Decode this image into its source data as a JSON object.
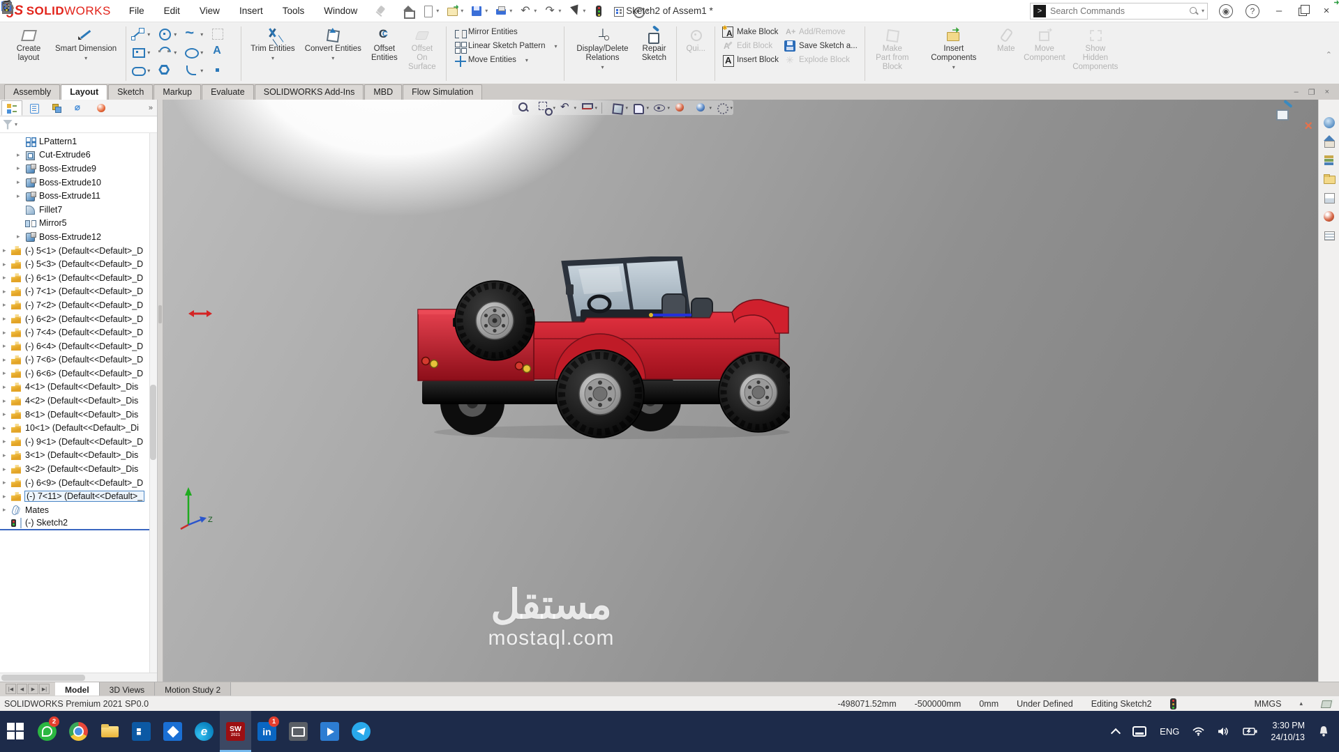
{
  "colors": {
    "brand_red": "#e2231a",
    "icon_blue": "#2b79b9",
    "taskbar_bg": "#1d2b4a",
    "selection_outline": "#4a86c5"
  },
  "titlebar": {
    "brand": "SOLIDWORKS",
    "menus": [
      {
        "label": "File"
      },
      {
        "label": "Edit"
      },
      {
        "label": "View"
      },
      {
        "label": "Insert"
      },
      {
        "label": "Tools"
      },
      {
        "label": "Window"
      }
    ],
    "quick_access": [
      {
        "name": "home"
      },
      {
        "name": "new",
        "caret": true
      },
      {
        "name": "open",
        "caret": true
      },
      {
        "name": "save",
        "caret": true
      },
      {
        "name": "print",
        "caret": true
      },
      {
        "name": "undo",
        "caret": true,
        "disabled": true
      },
      {
        "name": "redo",
        "caret": true,
        "disabled": true
      },
      {
        "name": "select",
        "caret": true,
        "active": true
      },
      {
        "name": "traffic"
      },
      {
        "name": "props"
      },
      {
        "name": "gear",
        "caret": true
      }
    ],
    "document_title": "Sketch2 of Assem1 *",
    "search_placeholder": "Search Commands"
  },
  "ribbon": {
    "create_layout": "Create layout",
    "smart_dimension": "Smart Dimension",
    "trim_entities": "Trim Entities",
    "convert_entities": "Convert Entities",
    "offset_entities": "Offset Entities",
    "offset_on_surface": "Offset On Surface",
    "mirror_entities": "Mirror Entities",
    "linear_sketch_pattern": "Linear Sketch Pattern",
    "move_entities": "Move Entities",
    "display_delete_relations": "Display/Delete Relations",
    "repair_sketch": "Repair Sketch",
    "quick_snaps": "Qui...",
    "make_block": "Make Block",
    "edit_block": "Edit Block",
    "insert_block": "Insert Block",
    "add_remove": "Add/Remove",
    "save_sketch": "Save Sketch a...",
    "explode_block": "Explode Block",
    "make_part_from_block": "Make Part from Block",
    "insert_components": "Insert Components",
    "mate": "Mate",
    "move_component": "Move Component",
    "show_hidden_components": "Show Hidden Components"
  },
  "command_tabs": [
    {
      "label": "Assembly"
    },
    {
      "label": "Layout",
      "active": true
    },
    {
      "label": "Sketch"
    },
    {
      "label": "Markup"
    },
    {
      "label": "Evaluate"
    },
    {
      "label": "SOLIDWORKS Add-Ins"
    },
    {
      "label": "MBD"
    },
    {
      "label": "Flow Simulation"
    }
  ],
  "panel_tabs": [
    {
      "name": "tree",
      "active": true
    },
    {
      "name": "prop"
    },
    {
      "name": "cfg"
    },
    {
      "name": "dim"
    },
    {
      "name": "app"
    }
  ],
  "feature_tree": {
    "items": [
      {
        "label": "LPattern1",
        "icon": "pattern",
        "arrow": false,
        "indent": 2
      },
      {
        "label": "Cut-Extrude6",
        "icon": "cut",
        "arrow": true,
        "indent": 2
      },
      {
        "label": "Boss-Extrude9",
        "icon": "boss",
        "arrow": true,
        "indent": 2
      },
      {
        "label": "Boss-Extrude10",
        "icon": "boss",
        "arrow": true,
        "indent": 2
      },
      {
        "label": "Boss-Extrude11",
        "icon": "boss",
        "arrow": true,
        "indent": 2
      },
      {
        "label": "Fillet7",
        "icon": "fillet",
        "arrow": false,
        "indent": 2
      },
      {
        "label": "Mirror5",
        "icon": "mirror",
        "arrow": false,
        "indent": 2
      },
      {
        "label": "Boss-Extrude12",
        "icon": "boss",
        "arrow": true,
        "indent": 2
      },
      {
        "label": "(-) 5<1> (Default<<Default>_D",
        "icon": "part",
        "arrow": true,
        "indent": 1
      },
      {
        "label": "(-) 5<3> (Default<<Default>_D",
        "icon": "part",
        "arrow": true,
        "indent": 1
      },
      {
        "label": "(-) 6<1> (Default<<Default>_D",
        "icon": "part",
        "arrow": true,
        "indent": 1
      },
      {
        "label": "(-) 7<1> (Default<<Default>_D",
        "icon": "part",
        "arrow": true,
        "indent": 1
      },
      {
        "label": "(-) 7<2> (Default<<Default>_D",
        "icon": "part",
        "arrow": true,
        "indent": 1
      },
      {
        "label": "(-) 6<2> (Default<<Default>_D",
        "icon": "part",
        "arrow": true,
        "indent": 1
      },
      {
        "label": "(-) 7<4> (Default<<Default>_D",
        "icon": "part",
        "arrow": true,
        "indent": 1
      },
      {
        "label": "(-) 6<4> (Default<<Default>_D",
        "icon": "part",
        "arrow": true,
        "indent": 1
      },
      {
        "label": "(-) 7<6> (Default<<Default>_D",
        "icon": "part",
        "arrow": true,
        "indent": 1
      },
      {
        "label": "(-) 6<6> (Default<<Default>_D",
        "icon": "part",
        "arrow": true,
        "indent": 1
      },
      {
        "label": "4<1> (Default<<Default>_Dis",
        "icon": "part",
        "arrow": true,
        "indent": 1
      },
      {
        "label": "4<2> (Default<<Default>_Dis",
        "icon": "part",
        "arrow": true,
        "indent": 1
      },
      {
        "label": "8<1> (Default<<Default>_Dis",
        "icon": "part",
        "arrow": true,
        "indent": 1
      },
      {
        "label": "10<1> (Default<<Default>_Di",
        "icon": "part",
        "arrow": true,
        "indent": 1
      },
      {
        "label": "(-) 9<1> (Default<<Default>_D",
        "icon": "part",
        "arrow": true,
        "indent": 1
      },
      {
        "label": "3<1> (Default<<Default>_Dis",
        "icon": "part",
        "arrow": true,
        "indent": 1
      },
      {
        "label": "3<2> (Default<<Default>_Dis",
        "icon": "part",
        "arrow": true,
        "indent": 1
      },
      {
        "label": "(-) 6<9> (Default<<Default>_D",
        "icon": "part",
        "arrow": true,
        "indent": 1
      },
      {
        "label": "(-) 7<11> (Default<<Default>_",
        "icon": "part",
        "arrow": true,
        "indent": 1,
        "selected": true
      },
      {
        "label": "Mates",
        "icon": "mates",
        "arrow": true,
        "indent": 1
      },
      {
        "label": "(-) Sketch2",
        "icon": "sketch",
        "arrow": false,
        "indent": 1,
        "underline": true
      }
    ]
  },
  "viewport": {
    "headsup": [
      {
        "name": "zoom-fit"
      },
      {
        "name": "zoom-area",
        "caret": true
      },
      {
        "name": "previous-view",
        "caret": true
      },
      {
        "name": "section-view",
        "caret": true
      },
      {
        "name": "sep"
      },
      {
        "name": "view-orientation",
        "caret": true
      },
      {
        "name": "display-style",
        "caret": true
      },
      {
        "name": "hide-show",
        "caret": true
      },
      {
        "name": "edit-appearance"
      },
      {
        "name": "scene",
        "caret": true
      },
      {
        "name": "view-settings",
        "caret": true
      }
    ],
    "triad_label": "Z"
  },
  "task_pane_tabs": [
    {
      "name": "navigate"
    },
    {
      "name": "home"
    },
    {
      "name": "library"
    },
    {
      "name": "files"
    },
    {
      "name": "palette"
    },
    {
      "name": "appearances"
    },
    {
      "name": "props"
    }
  ],
  "model_tabs": [
    {
      "label": "Model",
      "active": true
    },
    {
      "label": "3D Views"
    },
    {
      "label": "Motion Study 2"
    }
  ],
  "statusbar": {
    "left": "SOLIDWORKS Premium 2021 SP0.0",
    "coord_x": "-498071.52mm",
    "coord_y": "-500000mm",
    "coord_z": "0mm",
    "define_state": "Under Defined",
    "editing": "Editing Sketch2",
    "units": "MMGS"
  },
  "watermark": {
    "line1": "مستقل",
    "line2": "mostaql.com"
  },
  "taskbar": {
    "icons": [
      {
        "name": "start"
      },
      {
        "name": "whatsapp",
        "badge": "2"
      },
      {
        "name": "browser"
      },
      {
        "name": "explorer"
      },
      {
        "name": "store"
      },
      {
        "name": "photos"
      },
      {
        "name": "edge",
        "glyph": "e"
      },
      {
        "name": "solidworks",
        "glyph": "SW",
        "sub": "2021",
        "active": true
      },
      {
        "name": "linkedin",
        "glyph": "in",
        "badge": "1"
      },
      {
        "name": "screen"
      },
      {
        "name": "movies"
      },
      {
        "name": "telegram"
      }
    ],
    "tray": {
      "lang": "ENG",
      "time": "3:30 PM",
      "date": "24/10/13"
    }
  }
}
